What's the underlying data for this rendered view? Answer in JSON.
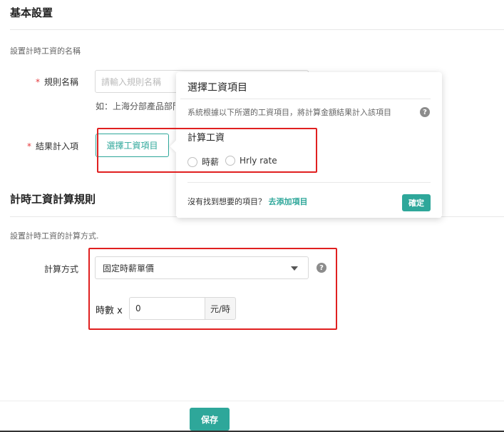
{
  "basic": {
    "title": "基本設置",
    "desc": "設置計時工資的名稱",
    "rule_name_label": "規則名稱",
    "rule_name_placeholder": "請輸入規則名稱",
    "rule_name_hint": "如：上海分部產品部門",
    "result_label": "結果計入項",
    "select_button": "選擇工資項目"
  },
  "popover": {
    "title": "選擇工資項目",
    "desc": "系統根據以下所選的工資項目，將計算金額結果計入該項目",
    "group_title": "計算工資",
    "options": [
      "時薪",
      "Hrly rate"
    ],
    "footer_text": "沒有找到想要的項目？",
    "footer_link": "去添加項目",
    "ok_button": "確定",
    "help_glyph": "?"
  },
  "rules": {
    "title": "計時工資計算規則",
    "desc": "設置計時工資的計算方式.",
    "method_label": "計算方式",
    "method_selected": "固定時薪單價",
    "help_glyph": "?",
    "hours_label": "時數 x",
    "hours_value": "0",
    "unit": "元/時"
  },
  "footer": {
    "save_button": "保存"
  },
  "colors": {
    "accent": "#2ea79a",
    "highlight_box": "#e02020",
    "required": "#e4393c"
  },
  "icons": {
    "help": "question-circle-icon",
    "dropdown": "caret-down-icon"
  }
}
